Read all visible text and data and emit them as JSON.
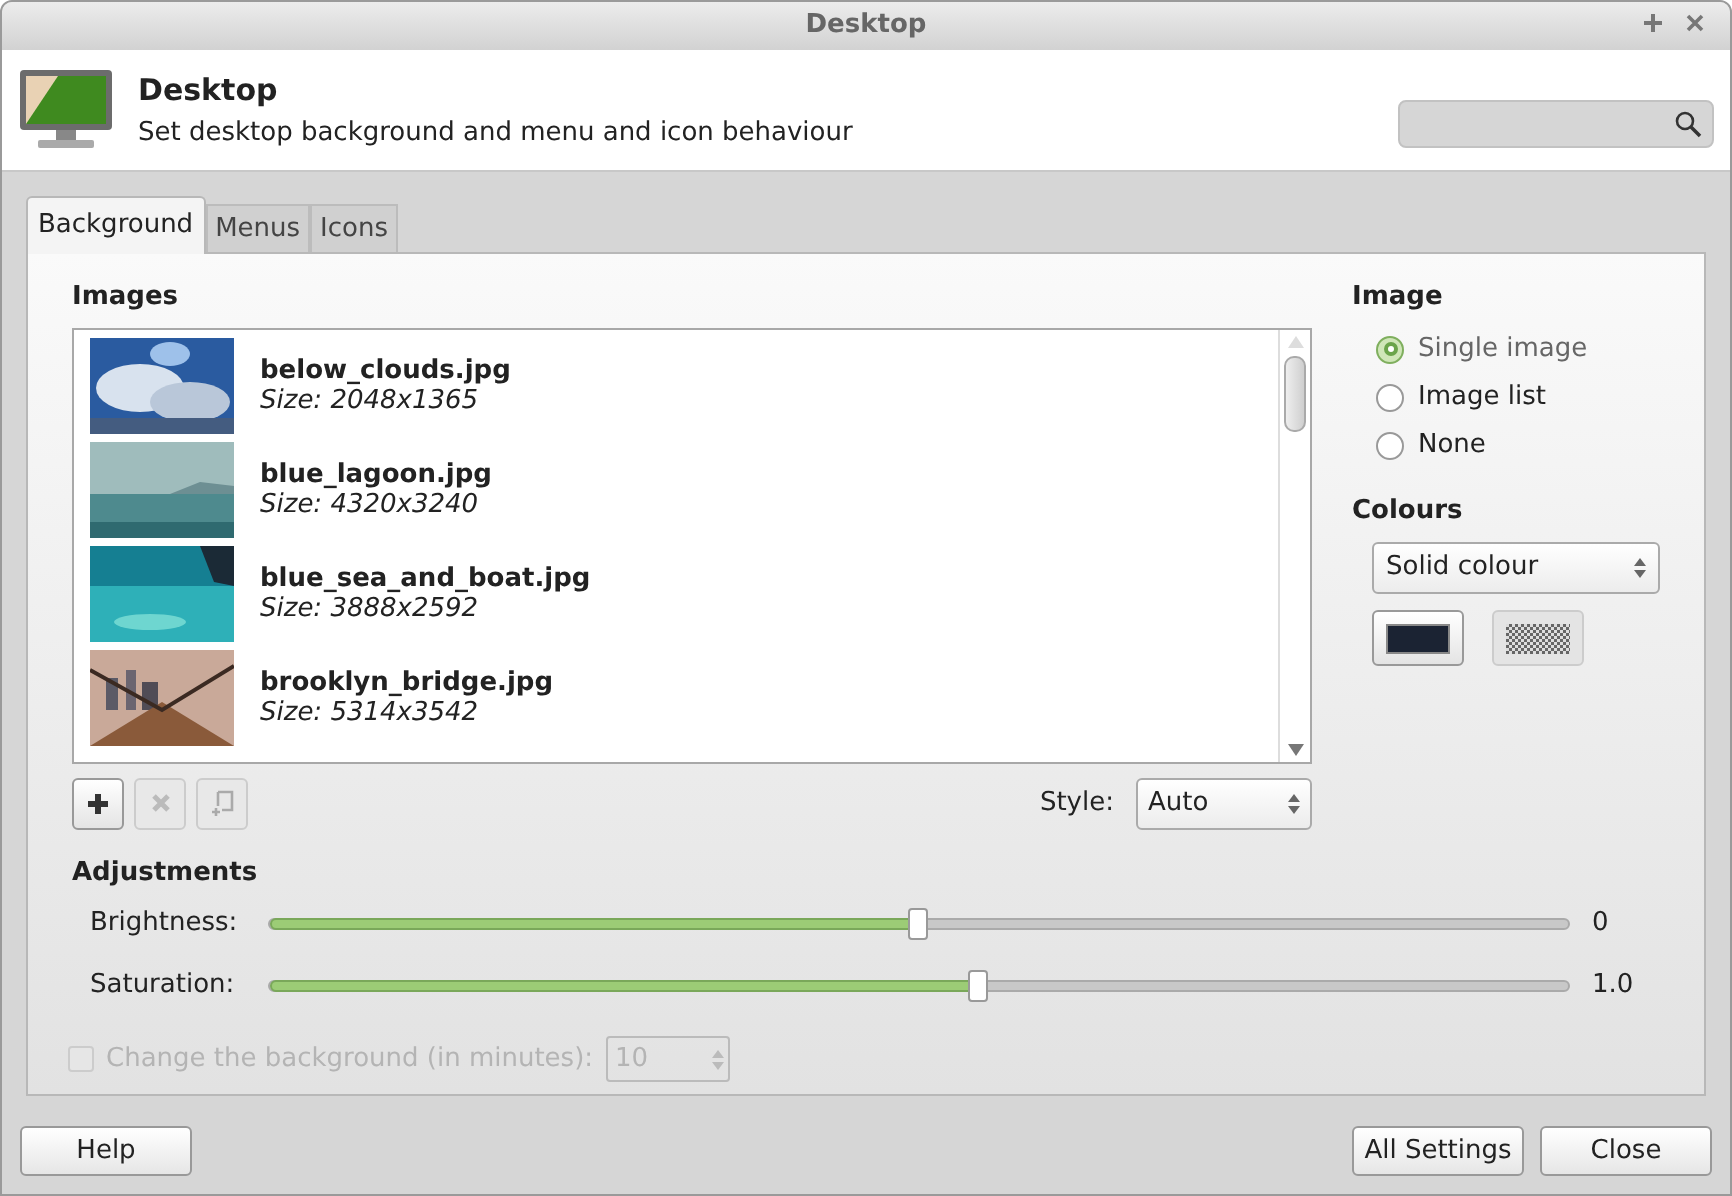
{
  "window": {
    "title": "Desktop"
  },
  "header": {
    "title": "Desktop",
    "subtitle": "Set desktop background and menu and icon behaviour"
  },
  "tabs": [
    {
      "label": "Background",
      "selected": true
    },
    {
      "label": "Menus",
      "selected": false
    },
    {
      "label": "Icons",
      "selected": false
    }
  ],
  "images": {
    "heading": "Images",
    "items": [
      {
        "name": "below_clouds.jpg",
        "size": "Size: 2048x1365"
      },
      {
        "name": "blue_lagoon.jpg",
        "size": "Size: 4320x3240"
      },
      {
        "name": "blue_sea_and_boat.jpg",
        "size": "Size: 3888x2592"
      },
      {
        "name": "brooklyn_bridge.jpg",
        "size": "Size: 5314x3542"
      }
    ],
    "style_label": "Style:",
    "style_value": "Auto"
  },
  "image_mode": {
    "heading": "Image",
    "options": [
      {
        "label": "Single image",
        "selected": true,
        "disabled": true
      },
      {
        "label": "Image list",
        "selected": false,
        "disabled": false
      },
      {
        "label": "None",
        "selected": false,
        "disabled": false
      }
    ]
  },
  "colours": {
    "heading": "Colours",
    "type": "Solid colour"
  },
  "adjustments": {
    "heading": "Adjustments",
    "sliders": [
      {
        "label": "Brightness:",
        "level": 0.5,
        "reading": "0"
      },
      {
        "label": "Saturation:",
        "level": 0.545,
        "reading": "1.0"
      }
    ]
  },
  "change_background": {
    "label": "Change the background (in minutes):",
    "checked": false,
    "disabled": true,
    "value": "10"
  },
  "buttons": {
    "left": [
      "Help"
    ],
    "right": [
      "All Settings",
      "Close"
    ]
  }
}
